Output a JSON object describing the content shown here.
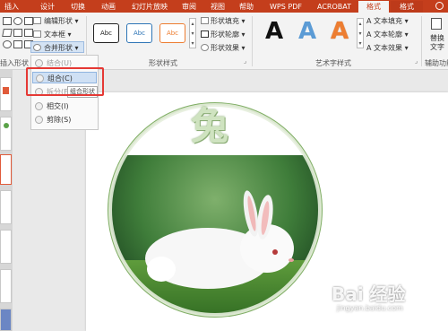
{
  "tabs": [
    "插入",
    "设计",
    "切换",
    "动画",
    "幻灯片放映",
    "审阅",
    "视图",
    "帮助",
    "WPS PDF",
    "ACROBAT",
    "格式",
    "格式"
  ],
  "insert_shapes": {
    "edit_shape": "编辑形状",
    "text_box": "文本框",
    "merge_shapes": "合并形状",
    "group_label": "插入形状"
  },
  "shape_styles": {
    "box_text": "Abc",
    "fill": "形状填充",
    "outline": "形状轮廓",
    "effects": "形状效果",
    "group_label": "形状样式",
    "colors": [
      "#222222",
      "#2e75b6",
      "#ed7d31"
    ]
  },
  "wordart": {
    "letter": "A",
    "text_fill": "文本填充",
    "text_outline": "文本轮廓",
    "text_effects": "文本效果",
    "group_label": "艺术字样式",
    "colors": [
      "#111111",
      "#5b9bd5",
      "#ed7d31"
    ]
  },
  "accessibility": {
    "alt_text_line1": "替换",
    "alt_text_line2": "文字",
    "group_label": "辅助功能"
  },
  "merge_menu": {
    "items": [
      "结合(U)",
      "组合(C)",
      "拆分(F)",
      "相交(I)",
      "剪除(S)"
    ],
    "highlighted": "组合(C)",
    "tooltip": "组合形状"
  },
  "slide": {
    "title_char": "兔"
  },
  "watermark": {
    "main": "Bai 经验",
    "sub": "jingyan.baidu.com"
  }
}
